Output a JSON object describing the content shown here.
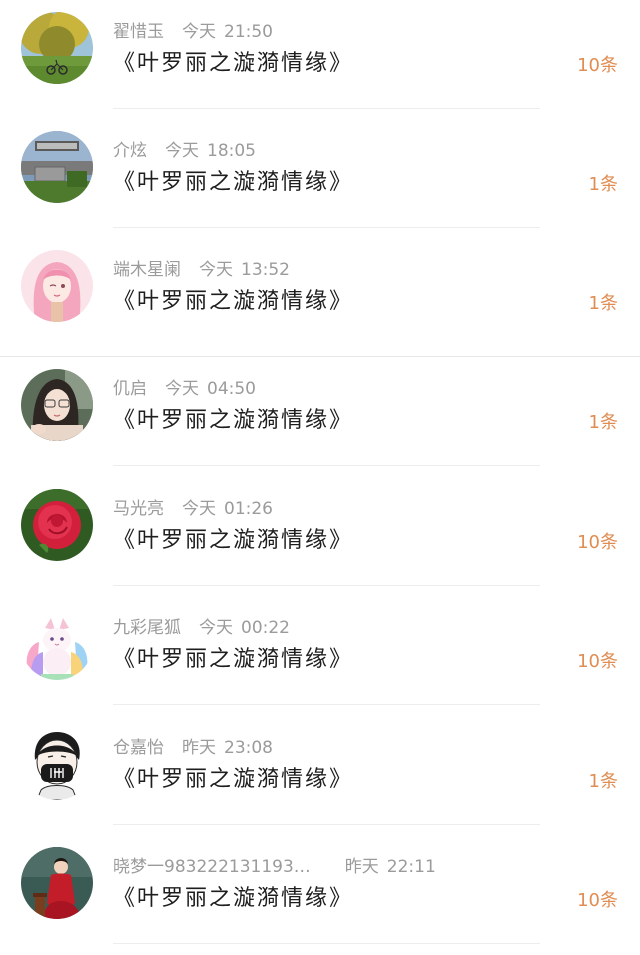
{
  "comments": [
    {
      "name": "翟惜玉",
      "day": "今天",
      "time": "21:50",
      "title": "《叶罗丽之漩漪情缘》",
      "count": "10条",
      "avatar": "park-bicycle-avatar"
    },
    {
      "name": "介炫",
      "day": "今天",
      "time": "18:05",
      "title": "《叶罗丽之漩漪情缘》",
      "count": "1条",
      "avatar": "minecraft-avatar"
    },
    {
      "name": "端木星阑",
      "day": "今天",
      "time": "13:52",
      "title": "《叶罗丽之漩漪情缘》",
      "count": "1条",
      "avatar": "pink-anime-girl-avatar"
    },
    {
      "name": "仉启",
      "day": "今天",
      "time": "04:50",
      "title": "《叶罗丽之漩漪情缘》",
      "count": "1条",
      "avatar": "selfie-girl-avatar"
    },
    {
      "name": "马光亮",
      "day": "今天",
      "time": "01:26",
      "title": "《叶罗丽之漩漪情缘》",
      "count": "10条",
      "avatar": "red-rose-avatar"
    },
    {
      "name": "九彩尾狐",
      "day": "今天",
      "time": "00:22",
      "title": "《叶罗丽之漩漪情缘》",
      "count": "10条",
      "avatar": "rainbow-fox-avatar"
    },
    {
      "name": "仓嘉怡",
      "day": "昨天",
      "time": "23:08",
      "title": "《叶罗丽之漩漪情缘》",
      "count": "1条",
      "avatar": "masked-boy-avatar"
    },
    {
      "name": "晓梦一983222131193…",
      "day": "昨天",
      "time": "22:11",
      "title": "《叶罗丽之漩漪情缘》",
      "count": "10条",
      "avatar": "red-dress-woman-avatar"
    }
  ],
  "colors": {
    "count_accent": "#e08d53",
    "meta_gray": "#9b9b9b",
    "title_text": "#1e1e1e"
  }
}
